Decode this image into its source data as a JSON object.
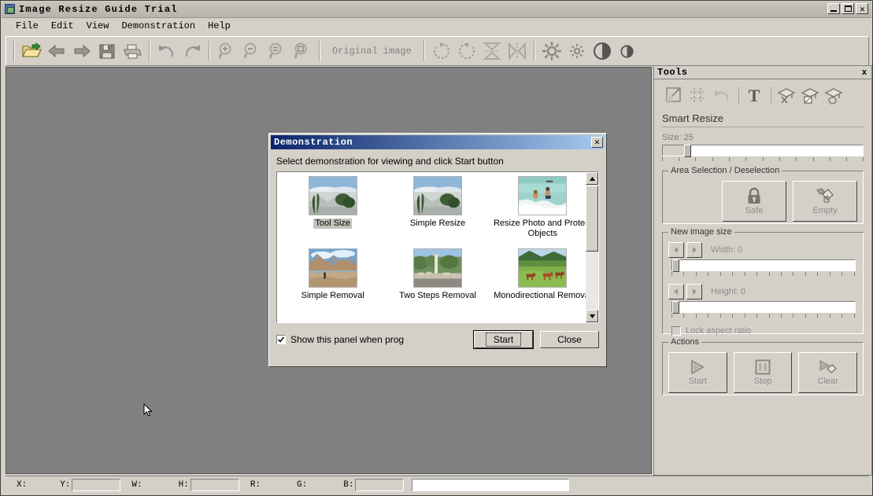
{
  "window": {
    "title": "Image Resize Guide Trial",
    "icon": "app-icon",
    "minimize": "_",
    "maximize": "□",
    "close": "✕"
  },
  "menubar": {
    "items": [
      {
        "label": "File"
      },
      {
        "label": "Edit"
      },
      {
        "label": "View"
      },
      {
        "label": "Demonstration"
      },
      {
        "label": "Help"
      }
    ]
  },
  "toolbar": {
    "original_image_label": "Original image",
    "buttons": [
      {
        "name": "open-file-icon",
        "title": "Open"
      },
      {
        "name": "back-arrow-icon",
        "title": "Back"
      },
      {
        "name": "forward-arrow-icon",
        "title": "Forward"
      },
      {
        "name": "save-icon",
        "title": "Save"
      },
      {
        "name": "print-icon",
        "title": "Print"
      },
      {
        "name": "undo-icon",
        "title": "Undo"
      },
      {
        "name": "redo-icon",
        "title": "Redo"
      },
      {
        "name": "zoom-in-icon",
        "title": "Zoom In"
      },
      {
        "name": "zoom-out-icon",
        "title": "Zoom Out"
      },
      {
        "name": "zoom-fit-icon",
        "title": "Zoom Fit"
      },
      {
        "name": "zoom-actual-icon",
        "title": "Actual Size"
      },
      {
        "name": "rotate-cw-icon",
        "title": "Rotate Clockwise"
      },
      {
        "name": "rotate-ccw-icon",
        "title": "Rotate Counter-Clockwise"
      },
      {
        "name": "flip-vertical-icon",
        "title": "Flip Vertical"
      },
      {
        "name": "flip-horizontal-icon",
        "title": "Flip Horizontal"
      },
      {
        "name": "brightness-up-icon",
        "title": "Brightness Up"
      },
      {
        "name": "brightness-down-icon",
        "title": "Brightness Down"
      },
      {
        "name": "contrast-up-icon",
        "title": "Contrast Up"
      },
      {
        "name": "contrast-down-icon",
        "title": "Contrast Down"
      }
    ]
  },
  "tools_panel": {
    "title": "Tools",
    "close_label": "x",
    "icons": [
      {
        "name": "smart-resize-icon"
      },
      {
        "name": "crop-grid-icon"
      },
      {
        "name": "undo-curve-icon"
      },
      {
        "name": "text-tool-icon",
        "glyph": "T"
      },
      {
        "name": "wizard-remove-icon"
      },
      {
        "name": "wizard-box-icon"
      },
      {
        "name": "wizard-gear-icon"
      }
    ],
    "section_title": "Smart Resize",
    "size": {
      "label": "Size: 25",
      "value": 25,
      "percent": 12
    },
    "area_selection": {
      "legend": "Area Selection / Deselection",
      "safe_button": {
        "label": "Safe",
        "icon": "lock-icon"
      },
      "empty_button": {
        "label": "Empty",
        "icon": "eraser-icon"
      }
    },
    "new_image_size": {
      "legend": "New image size",
      "width": {
        "label": "Width: 0",
        "value": 0,
        "percent": 1
      },
      "height": {
        "label": "Height: 0",
        "value": 0,
        "percent": 1
      },
      "lock_aspect": {
        "label": "Lock aspect ratio",
        "checked": false
      },
      "dec_icon": "arrow-left-icon",
      "inc_icon": "arrow-right-icon"
    },
    "actions": {
      "legend": "Actions",
      "buttons": [
        {
          "label": "Start",
          "icon": "play-icon"
        },
        {
          "label": "Stop",
          "icon": "stop-icon"
        },
        {
          "label": "Clear",
          "icon": "clear-icon"
        }
      ]
    }
  },
  "dialog": {
    "title": "Demonstration",
    "close_label": "✕",
    "instruction": "Select demonstration for viewing and click Start button",
    "items": [
      {
        "label": "Tool Size",
        "selected": true,
        "thumb": "mountain-cypress"
      },
      {
        "label": "Simple Resize",
        "selected": false,
        "thumb": "mountain-cypress"
      },
      {
        "label": "Resize Photo and Protect Objects",
        "selected": false,
        "thumb": "sea-swimmers"
      },
      {
        "label": "Simple Removal",
        "selected": false,
        "thumb": "canyon-hiker"
      },
      {
        "label": "Two Steps Removal",
        "selected": false,
        "thumb": "ruins-column"
      },
      {
        "label": "Monodirectional Removal",
        "selected": false,
        "thumb": "green-field-horses"
      }
    ],
    "show_panel_checkbox": {
      "label": "Show this panel when prog",
      "checked": true
    },
    "start_button": "Start",
    "close_button": "Close",
    "scrollbar": {
      "up_arrow": "▲",
      "down_arrow": "▼"
    }
  },
  "statusbar": {
    "fields": [
      {
        "label": "X:",
        "value": ""
      },
      {
        "label": "Y:",
        "value": ""
      },
      {
        "label": "W:",
        "value": ""
      },
      {
        "label": "H:",
        "value": ""
      },
      {
        "label": "R:",
        "value": ""
      },
      {
        "label": "G:",
        "value": ""
      },
      {
        "label": "B:",
        "value": ""
      }
    ],
    "message": ""
  },
  "colors": {
    "face": "#d4d0c8",
    "canvas": "#808080",
    "title_active": "#0a246a",
    "disabled_text": "#8c8c8c"
  }
}
